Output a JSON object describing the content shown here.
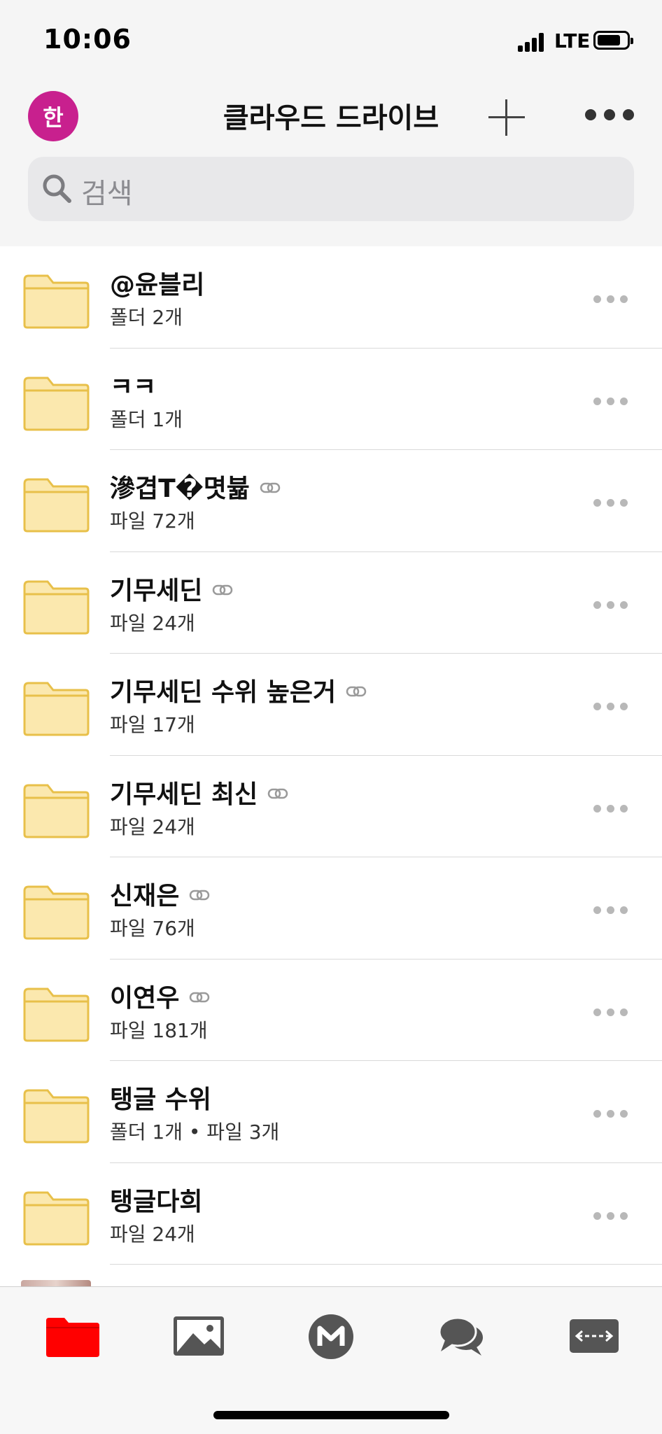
{
  "status_bar": {
    "time": "10:06",
    "network": "LTE"
  },
  "nav": {
    "avatar_initial": "한",
    "title": "클라우드 드라이브"
  },
  "search": {
    "placeholder": "검색"
  },
  "folders": [
    {
      "name": "@윤블리",
      "sub": "폴더 2개",
      "shared": false
    },
    {
      "name": "ㅋㅋ",
      "sub": "폴더 1개",
      "shared": false
    },
    {
      "name": "滲겹T�몃뷻",
      "sub": "파일 72개",
      "shared": true
    },
    {
      "name": "기무세딘",
      "sub": "파일 24개",
      "shared": true
    },
    {
      "name": "기무세딘 수위 높은거",
      "sub": "파일 17개",
      "shared": true
    },
    {
      "name": "기무세딘 최신",
      "sub": "파일 24개",
      "shared": true
    },
    {
      "name": "신재은",
      "sub": "파일 76개",
      "shared": true
    },
    {
      "name": "이연우",
      "sub": "파일 181개",
      "shared": true
    },
    {
      "name": "탱글 수위",
      "sub": "폴더 1개 • 파일 3개",
      "shared": false
    },
    {
      "name": "탱글다희",
      "sub": "파일 24개",
      "shared": false
    }
  ],
  "tabs": [
    {
      "icon": "folder-icon",
      "active": true
    },
    {
      "icon": "photo-icon",
      "active": false
    },
    {
      "icon": "m-logo-icon",
      "active": false
    },
    {
      "icon": "chat-icon",
      "active": false
    },
    {
      "icon": "transfer-icon",
      "active": false
    }
  ],
  "colors": {
    "accent": "#ff0000",
    "avatar": "#c8208e",
    "folder_fill": "#fbe8ae",
    "folder_stroke": "#e8c04a"
  }
}
